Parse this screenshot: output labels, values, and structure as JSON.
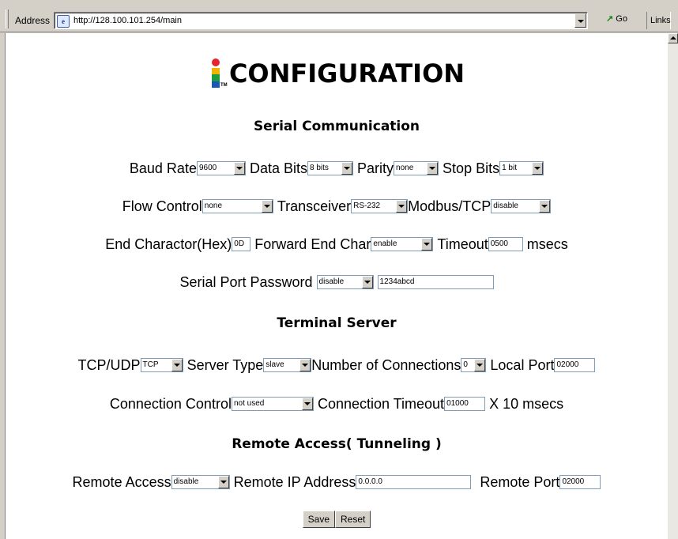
{
  "browser": {
    "address_label": "Address",
    "url": "http://128.100.101.254/main",
    "go_label": "Go",
    "links_label": "Links"
  },
  "page": {
    "title": "CONFIGURATION",
    "sections": {
      "serial": "Serial Communication",
      "terminal": "Terminal Server",
      "remote": "Remote Access( Tunneling )"
    },
    "serial": {
      "baud_rate": {
        "label": "Baud Rate",
        "value": "9600"
      },
      "data_bits": {
        "label": "Data Bits",
        "value": "8 bits"
      },
      "parity": {
        "label": "Parity",
        "value": "none"
      },
      "stop_bits": {
        "label": "Stop Bits",
        "value": "1 bit"
      },
      "flow_control": {
        "label": "Flow Control",
        "value": "none"
      },
      "transceiver": {
        "label": "Transceiver",
        "value": "RS-232"
      },
      "modbus_tcp": {
        "label": "Modbus/TCP",
        "value": "disable"
      },
      "end_char": {
        "label": "End Charactor(Hex)",
        "value": "0D"
      },
      "forward_end_char": {
        "label": "Forward End Char",
        "value": "enable"
      },
      "timeout": {
        "label": "Timeout",
        "value": "0500",
        "unit": "msecs"
      },
      "password": {
        "label": "Serial Port Password",
        "select_value": "disable",
        "input_value": "1234abcd"
      }
    },
    "terminal": {
      "tcp_udp": {
        "label": "TCP/UDP",
        "value": "TCP"
      },
      "server_type": {
        "label": "Server Type",
        "value": "slave"
      },
      "num_connections": {
        "label": "Number of Connections",
        "value": "0"
      },
      "local_port": {
        "label": "Local Port",
        "value": "02000"
      },
      "connection_control": {
        "label": "Connection Control",
        "value": "not used"
      },
      "connection_timeout": {
        "label": "Connection Timeout",
        "value": "01000",
        "unit": "X 10 msecs"
      }
    },
    "remote": {
      "remote_access": {
        "label": "Remote Access",
        "value": "disable"
      },
      "remote_ip": {
        "label": "Remote IP Address",
        "value": "0.0.0.0"
      },
      "remote_port": {
        "label": "Remote Port",
        "value": "02000"
      }
    },
    "buttons": {
      "save": "Save",
      "reset": "Reset"
    }
  }
}
